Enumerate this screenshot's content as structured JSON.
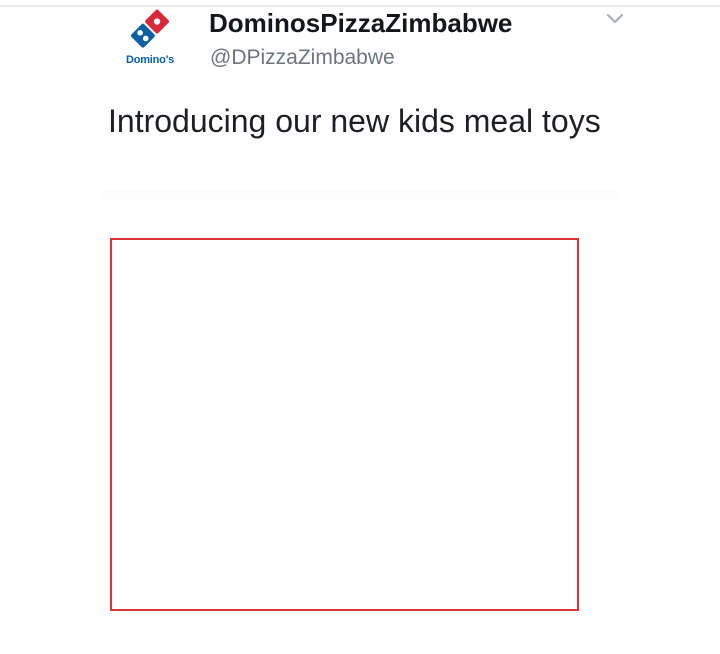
{
  "tweet": {
    "avatar": {
      "logo_text": "Domino's",
      "icon": "dominos-logo-icon",
      "colors": {
        "tile_red": "#d8283a",
        "tile_blue": "#0b5fa5",
        "dot": "#ffffff"
      }
    },
    "display_name": "DominosPizzaZimbabwe",
    "handle": "@DPizzaZimbabwe",
    "menu_icon": "chevron-down-icon",
    "text": "Introducing our new kids meal toys",
    "media": {
      "border_color": "#d93535"
    }
  }
}
